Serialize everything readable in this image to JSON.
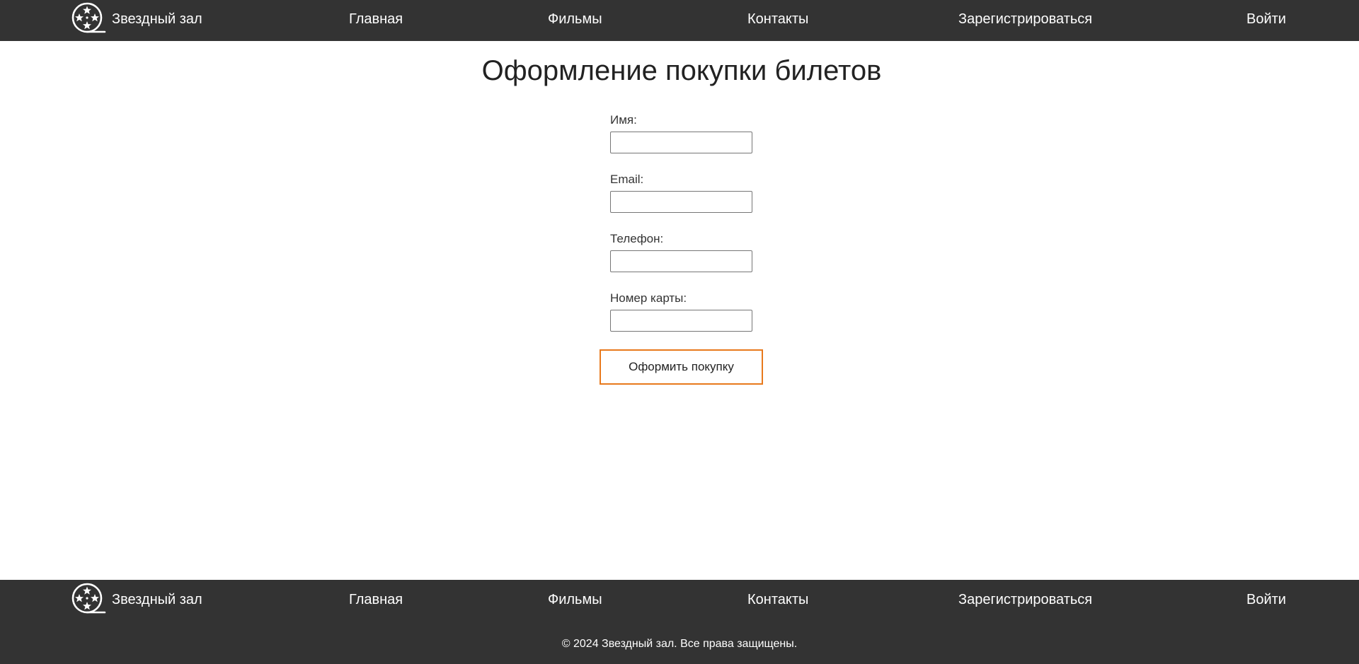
{
  "header": {
    "brand": "Звездный зал",
    "nav": {
      "home": "Главная",
      "films": "Фильмы",
      "contacts": "Контакты",
      "register": "Зарегистрироваться",
      "login": "Войти"
    }
  },
  "main": {
    "title": "Оформление покупки билетов",
    "form": {
      "name_label": "Имя:",
      "name_value": "",
      "email_label": "Email:",
      "email_value": "",
      "phone_label": "Телефон:",
      "phone_value": "",
      "card_label": "Номер карты:",
      "card_value": "",
      "submit_label": "Оформить покупку"
    }
  },
  "footer": {
    "brand": "Звездный зал",
    "nav": {
      "home": "Главная",
      "films": "Фильмы",
      "contacts": "Контакты",
      "register": "Зарегистрироваться",
      "login": "Войти"
    },
    "copyright": "© 2024 Звездный зал. Все права защищены."
  },
  "colors": {
    "bar_background": "#333333",
    "bar_text": "#ffffff",
    "button_border": "#e8791c",
    "page_background": "#ffffff"
  },
  "icons": {
    "logo": "film-reel-stars-icon"
  }
}
